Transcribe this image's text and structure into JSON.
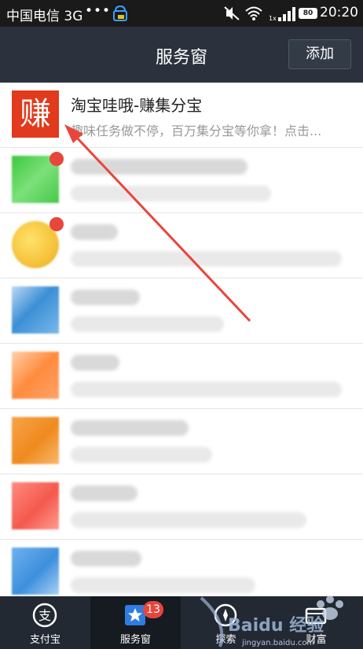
{
  "status_bar": {
    "carrier": "中国电信 3G",
    "dots": "•••",
    "time": "20:20",
    "battery": "80"
  },
  "header": {
    "title": "服务窗",
    "add_label": "添加"
  },
  "list": {
    "first_item": {
      "avatar_char": "赚",
      "title": "淘宝哇哦-赚集分宝",
      "subtitle": "趣味任务做不停，百万集分宝等你拿！点击..."
    }
  },
  "tabs": [
    {
      "label": "支付宝",
      "icon": "alipay-icon"
    },
    {
      "label": "服务窗",
      "icon": "star-window-icon",
      "badge": "13"
    },
    {
      "label": "探索",
      "icon": "explore-icon"
    },
    {
      "label": "财富",
      "icon": "wealth-icon"
    }
  ],
  "watermark": {
    "text": "Baidu 经验",
    "url_text": "jingyan.baidu.com"
  },
  "colors": {
    "header_bg": "#2b323d",
    "tab_bar_bg": "#222933",
    "accent_red": "#e8453c",
    "annotation_arrow": "#e8453c"
  }
}
